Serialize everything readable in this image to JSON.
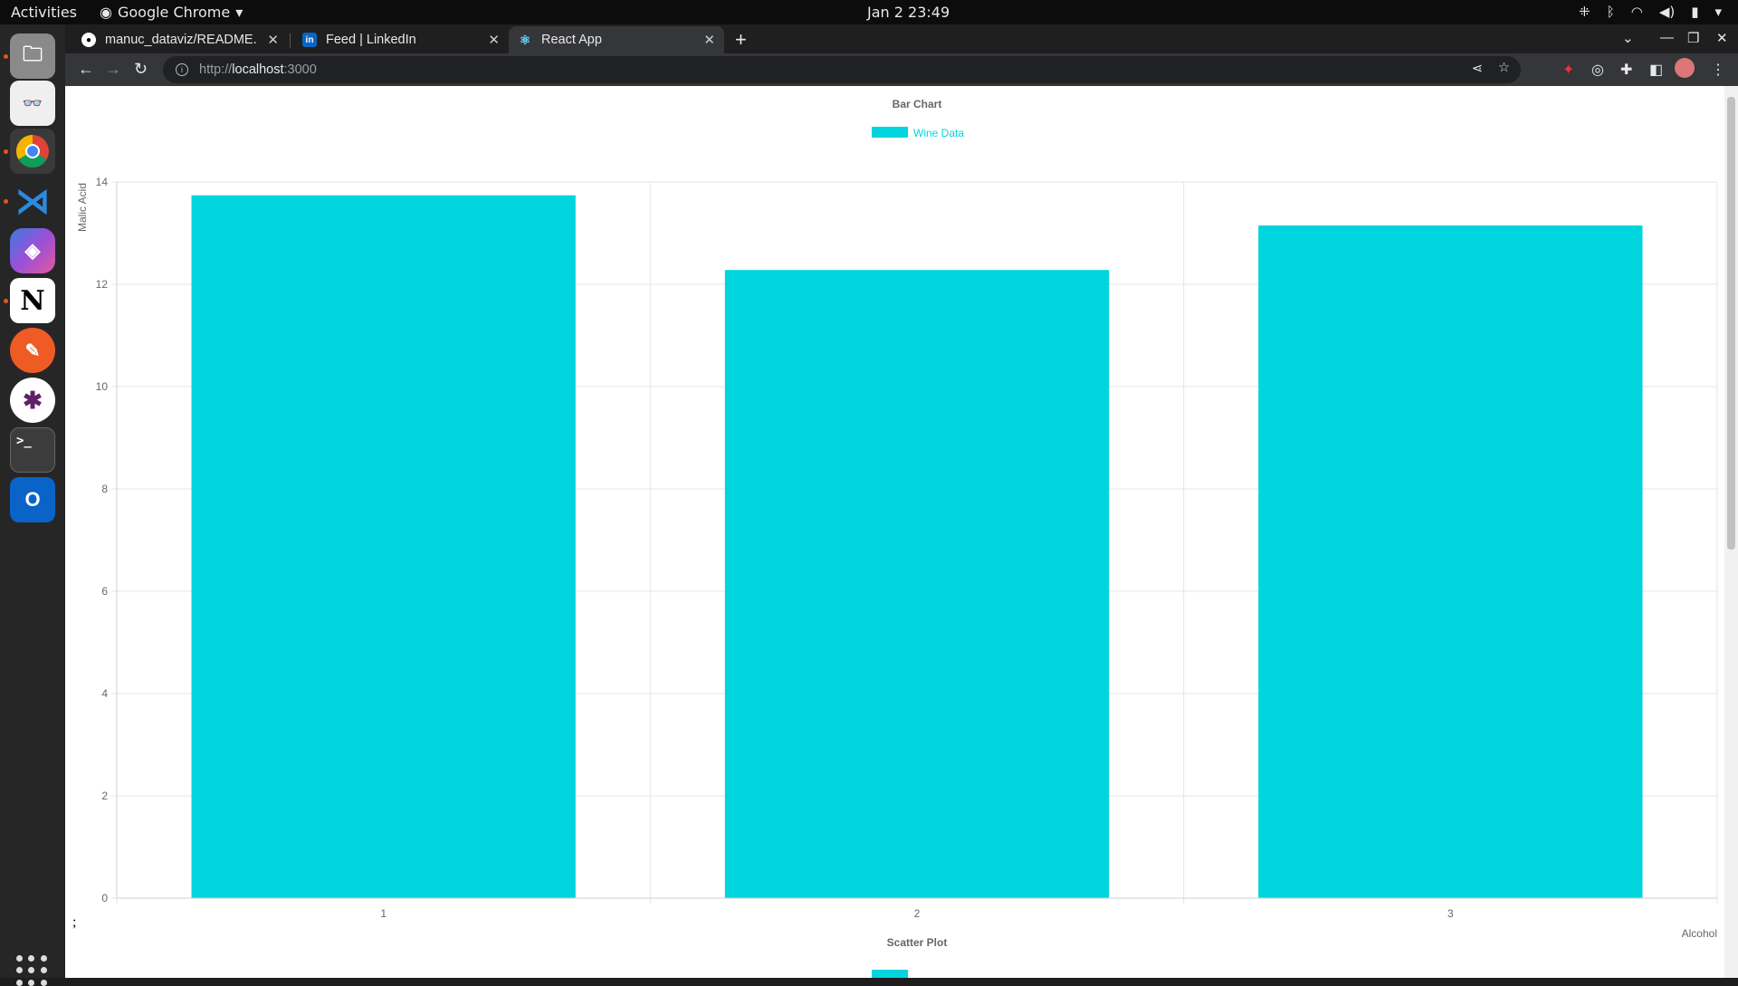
{
  "system_bar": {
    "activities": "Activities",
    "app_name": "Google Chrome",
    "clock": "Jan 2  23:49"
  },
  "dock": {
    "items": [
      "files",
      "document-viewer",
      "google-chrome",
      "vscode",
      "microsoft-365",
      "notion",
      "postman",
      "slack",
      "terminal",
      "outlook"
    ]
  },
  "browser": {
    "tabs": [
      {
        "title": "manuc_dataviz/README.",
        "favicon": "github-icon"
      },
      {
        "title": "Feed | LinkedIn",
        "favicon": "linkedin-icon"
      },
      {
        "title": "React App",
        "favicon": "react-icon"
      }
    ],
    "url_scheme": "http://",
    "url_host": "localhost",
    "url_port": ":3000"
  },
  "page": {
    "stray_text": ";",
    "second_chart_title": "Scatter Plot"
  },
  "colors": {
    "bar_fill": "#00d5de",
    "legend_text": "#00d5de"
  },
  "chart_data": {
    "type": "bar",
    "title": "Bar Chart",
    "legend": [
      "Wine Data"
    ],
    "legend_position": "top",
    "categories": [
      "1",
      "2",
      "3"
    ],
    "series": [
      {
        "name": "Wine Data",
        "values": [
          13.74,
          12.28,
          13.15
        ]
      }
    ],
    "xlabel": "Alcohol",
    "ylabel": "Malic Acid",
    "ylim": [
      0,
      14
    ],
    "yticks": [
      "0",
      "2",
      "4",
      "6",
      "8",
      "10",
      "12",
      "14"
    ],
    "grid": true
  }
}
